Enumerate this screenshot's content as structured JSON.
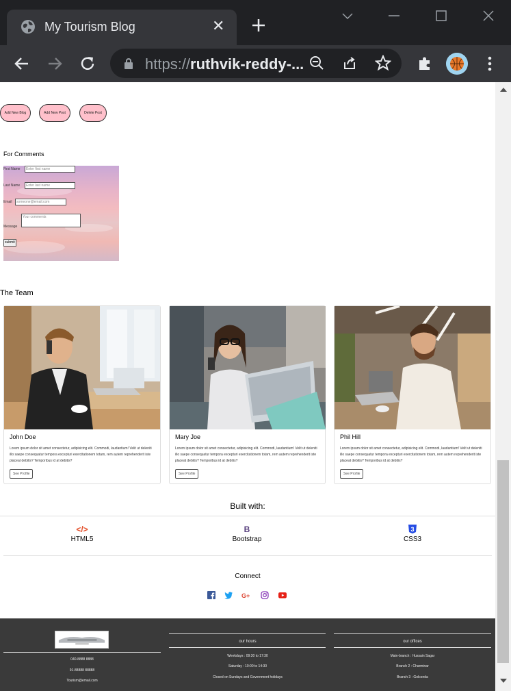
{
  "browser": {
    "tab_title": "My Tourism Blog",
    "url_prefix": "https://",
    "url_host": "ruthvik-reddy-..."
  },
  "actions": {
    "add_blog": "Add New Blog",
    "add_post": "Add New Post",
    "delete_post": "Delete Post"
  },
  "comments": {
    "title": "For Comments",
    "first_name_label": "First Name",
    "first_name_placeholder": "Enter first name",
    "last_name_label": "Last Name",
    "last_name_placeholder": "Enter last name",
    "email_label": "Email",
    "email_placeholder": "someone@email.com",
    "message_label": "Message",
    "message_placeholder": "Your comments",
    "submit_label": "submit"
  },
  "team": {
    "title": "The Team",
    "members": [
      {
        "name": "John Doe",
        "text": "Lorem ipsum dolor sit amet consectetur, adipisicing elit. Commodi, laudantium! Velit ut deleniti illo saepe consequatur tempora excepturi exercitationem totam, rem autem reprehenderit iste placeat debitis? Temporibus id at debitis?",
        "button": "See Profile"
      },
      {
        "name": "Mary Joe",
        "text": "Lorem ipsum dolor sit amet consectetur, adipisicing elit. Commodi, laudantium! Velit ut deleniti illo saepe consequatur tempora excepturi exercitationem totam, rem autem reprehenderit iste placeat debitis? Temporibus id at debitis?",
        "button": "See Profile"
      },
      {
        "name": "Phil Hill",
        "text": "Lorem ipsum dolor sit amet consectetur, adipisicing elit. Commodi, laudantium! Velit ut deleniti illo saepe consequatur tempora excepturi exercitationem totam, rem autem reprehenderit iste placeat debitis? Temporibus id at debitis?",
        "button": "See Profile"
      }
    ]
  },
  "built_with": {
    "title": "Built with:",
    "items": [
      {
        "label": "HTML5",
        "icon": "code-icon",
        "glyph": "</>",
        "color": "#e34c26"
      },
      {
        "label": "Bootstrap",
        "icon": "bootstrap-icon",
        "glyph": "B",
        "color": "#563d7c"
      },
      {
        "label": "CSS3",
        "icon": "css3-icon",
        "glyph": "3",
        "color": "#264de4"
      }
    ]
  },
  "connect": {
    "title": "Connect",
    "icons": [
      "facebook-icon",
      "twitter-icon",
      "google-plus-icon",
      "instagram-icon",
      "youtube-icon"
    ],
    "colors": {
      "facebook": "#3b5998",
      "twitter": "#1da1f2",
      "google": "#dd4b39",
      "instagram": "#8a3ab9",
      "youtube": "#e62117"
    }
  },
  "footer": {
    "contact": [
      "040-8888 8888",
      "91-88888 88888",
      "Tourism@email.com"
    ],
    "hours_title": "our hours",
    "hours": [
      "Weekdays : 09:30 to 17:30",
      "Saturday : 10:00 to 14:30",
      "Closed on Sundays and Government holidays"
    ],
    "offices_title": "our offices",
    "offices": [
      "Main-branch : Hussain Sagar",
      "Branch 2 : Charminar",
      "Branch 3 : Golconda"
    ]
  },
  "colors": {
    "pill_bg": "#ffc0cb",
    "footer_bg": "#3a3a3a",
    "chrome_dark": "#202124",
    "chrome_toolbar": "#35363a"
  }
}
